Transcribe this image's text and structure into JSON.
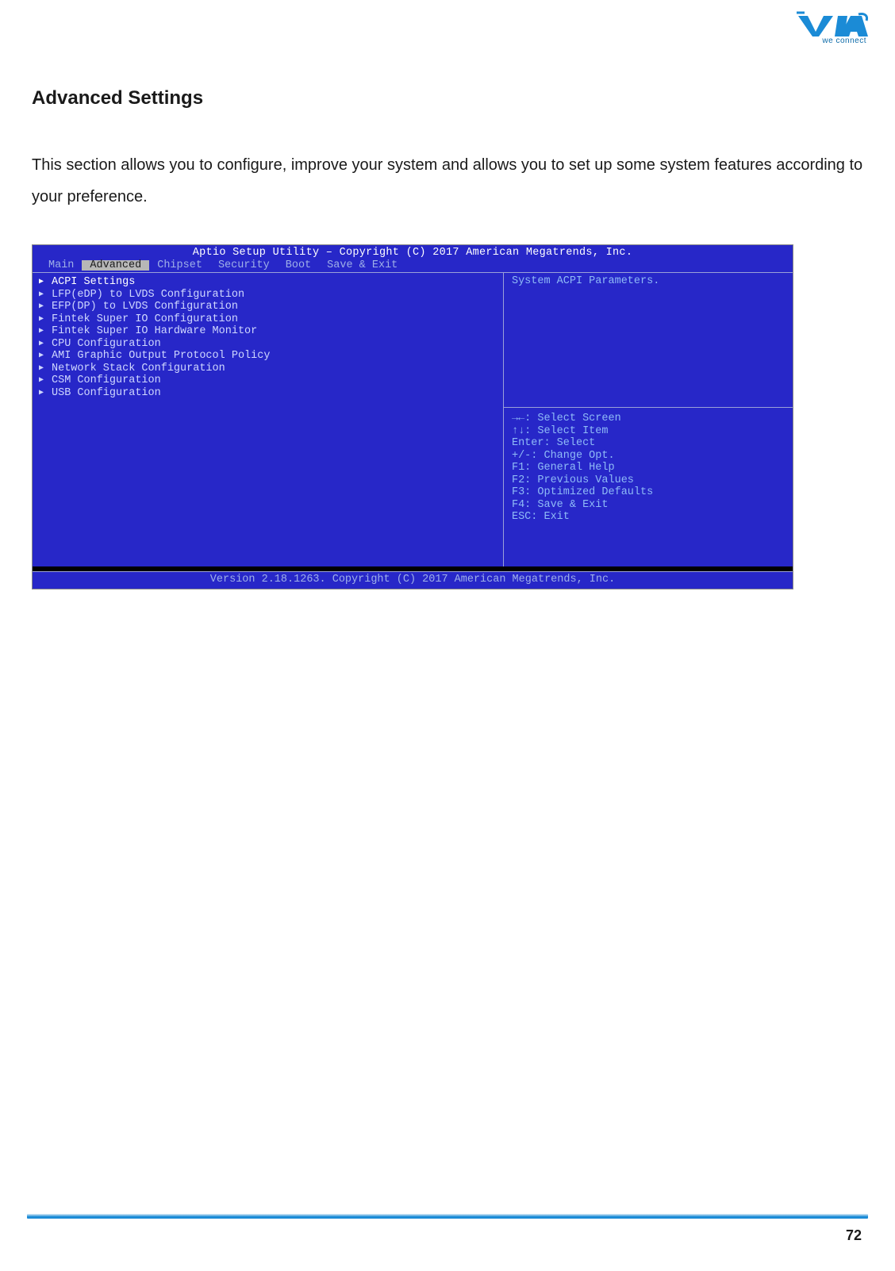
{
  "logo": {
    "brand": "VIA",
    "tagline": "we connect"
  },
  "heading": "Advanced Settings",
  "paragraph": "This section allows you to configure, improve your system and allows you to set up some system features according to your preference.",
  "bios": {
    "title": "Aptio Setup Utility – Copyright (C) 2017 American Megatrends, Inc.",
    "tabs": [
      "Main",
      "Advanced",
      "Chipset",
      "Security",
      "Boot",
      "Save & Exit"
    ],
    "active_tab_index": 1,
    "menu_items": [
      "ACPI Settings",
      "LFP(eDP) to LVDS Configuration",
      "EFP(DP) to LVDS Configuration",
      "Fintek Super IO Configuration",
      "Fintek Super IO Hardware Monitor",
      "CPU Configuration",
      "AMI Graphic Output Protocol Policy",
      "Network Stack Configuration",
      "CSM Configuration",
      "USB Configuration"
    ],
    "highlighted_index": 0,
    "help_text": "System ACPI Parameters.",
    "key_hints": [
      "→←: Select Screen",
      "↑↓: Select Item",
      "Enter: Select",
      "+/-: Change Opt.",
      "F1: General Help",
      "F2: Previous Values",
      "F3: Optimized Defaults",
      "F4: Save & Exit",
      "ESC: Exit"
    ],
    "footer": "Version 2.18.1263. Copyright (C) 2017 American Megatrends, Inc."
  },
  "page_number": "72"
}
